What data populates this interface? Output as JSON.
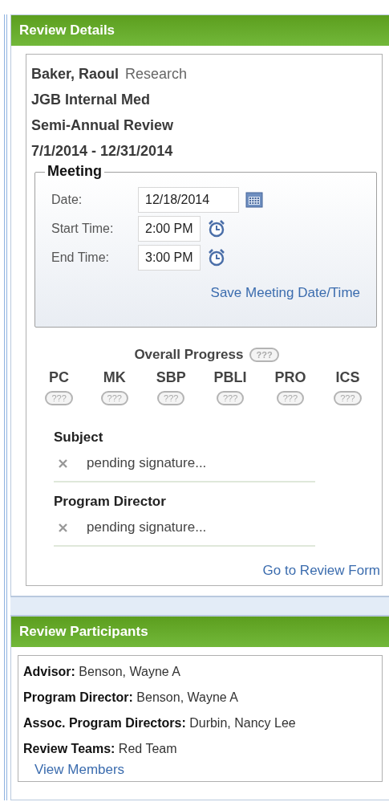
{
  "review_details": {
    "title": "Review Details",
    "name": "Baker, Raoul",
    "department": "Research",
    "program": "JGB Internal Med",
    "review_type": "Semi-Annual Review",
    "period": "7/1/2014 - 12/31/2014",
    "meeting": {
      "legend": "Meeting",
      "fields": [
        {
          "kind": "date",
          "label": "Date:",
          "value": "12/18/2014"
        },
        {
          "kind": "time",
          "label": "Start Time:",
          "value": "2:00 PM"
        },
        {
          "kind": "time",
          "label": "End Time:",
          "value": "3:00 PM"
        }
      ],
      "save_link": "Save Meeting Date/Time"
    },
    "overall_progress": {
      "label": "Overall Progress",
      "badge": "???"
    },
    "competencies": [
      {
        "label": "PC",
        "badge": "???"
      },
      {
        "label": "MK",
        "badge": "???"
      },
      {
        "label": "SBP",
        "badge": "???"
      },
      {
        "label": "PBLI",
        "badge": "???"
      },
      {
        "label": "PRO",
        "badge": "???"
      },
      {
        "label": "ICS",
        "badge": "???"
      }
    ],
    "signatures": [
      {
        "role": "Subject",
        "status": "pending signature...",
        "signed": false
      },
      {
        "role": "Program Director",
        "status": "pending signature...",
        "signed": false
      }
    ],
    "review_form_link": "Go to Review Form"
  },
  "review_participants": {
    "title": "Review Participants",
    "lines": [
      "**Advisor:** Benson, Wayne A",
      "**Program Director:** Benson, Wayne A",
      "**Assoc. Program Directors:** Durbin, Nancy Lee",
      "**Review Teams:** Red Team"
    ],
    "view_members_link": "View Members"
  }
}
